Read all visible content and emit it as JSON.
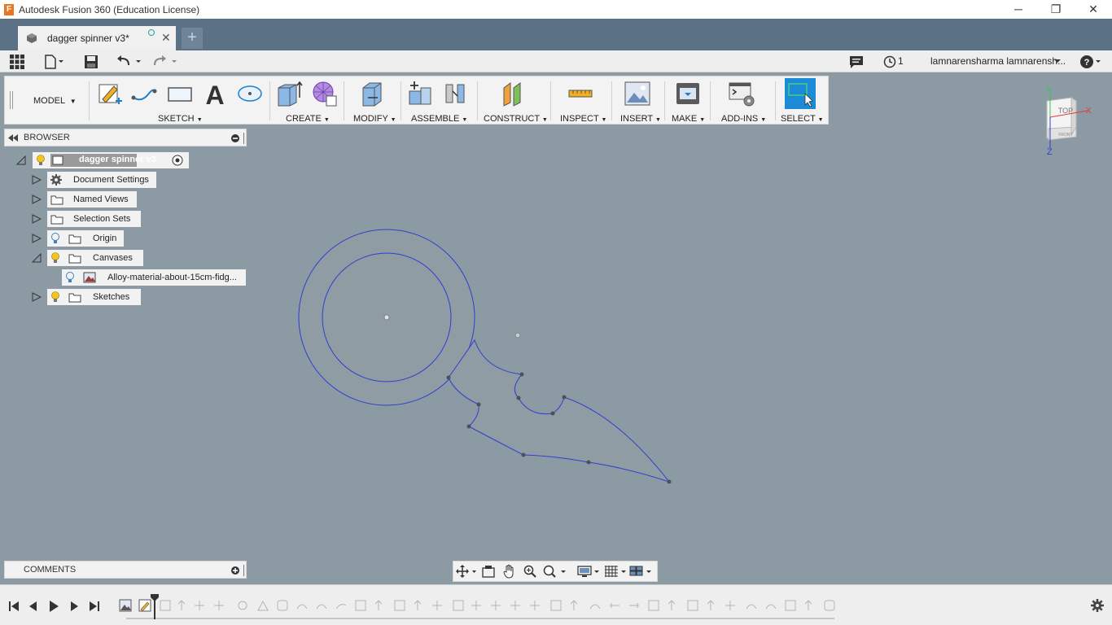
{
  "window": {
    "title": "Autodesk Fusion 360 (Education License)",
    "app_icon_letter": "F",
    "controls": [
      "─",
      "❐",
      "✕"
    ]
  },
  "tabs": {
    "active_label": "dagger spinner v3*",
    "close_glyph": "✕",
    "new_tab_glyph": "+"
  },
  "quick_access": {
    "job_count": "1",
    "user": "lamnarensharma lamnarensh...",
    "help_glyph": "?"
  },
  "toolbar": {
    "workspace": "MODEL",
    "groups": [
      "SKETCH",
      "CREATE",
      "MODIFY",
      "ASSEMBLE",
      "CONSTRUCT",
      "INSPECT",
      "INSERT",
      "MAKE",
      "ADD-INS",
      "SELECT"
    ]
  },
  "browser": {
    "title": "BROWSER",
    "root": "dagger spinner v3",
    "nodes": {
      "document_settings": "Document Settings",
      "named_views": "Named Views",
      "selection_sets": "Selection Sets",
      "origin": "Origin",
      "canvases": "Canvases",
      "canvas_item": "Alloy-material-about-15cm-fidg...",
      "sketches": "Sketches"
    }
  },
  "comments": {
    "title": "COMMENTS"
  },
  "viewcube": {
    "face_top": "TOP",
    "face_front": "FRONT",
    "axis_x": "X",
    "axis_y": "Y",
    "axis_z": "Z"
  },
  "colors": {
    "viewport_bg": "#8c9aa3",
    "sketch_line": "#2f3fd0",
    "select_blue": "#1d8ad8",
    "tab_bar": "#5b7186"
  }
}
